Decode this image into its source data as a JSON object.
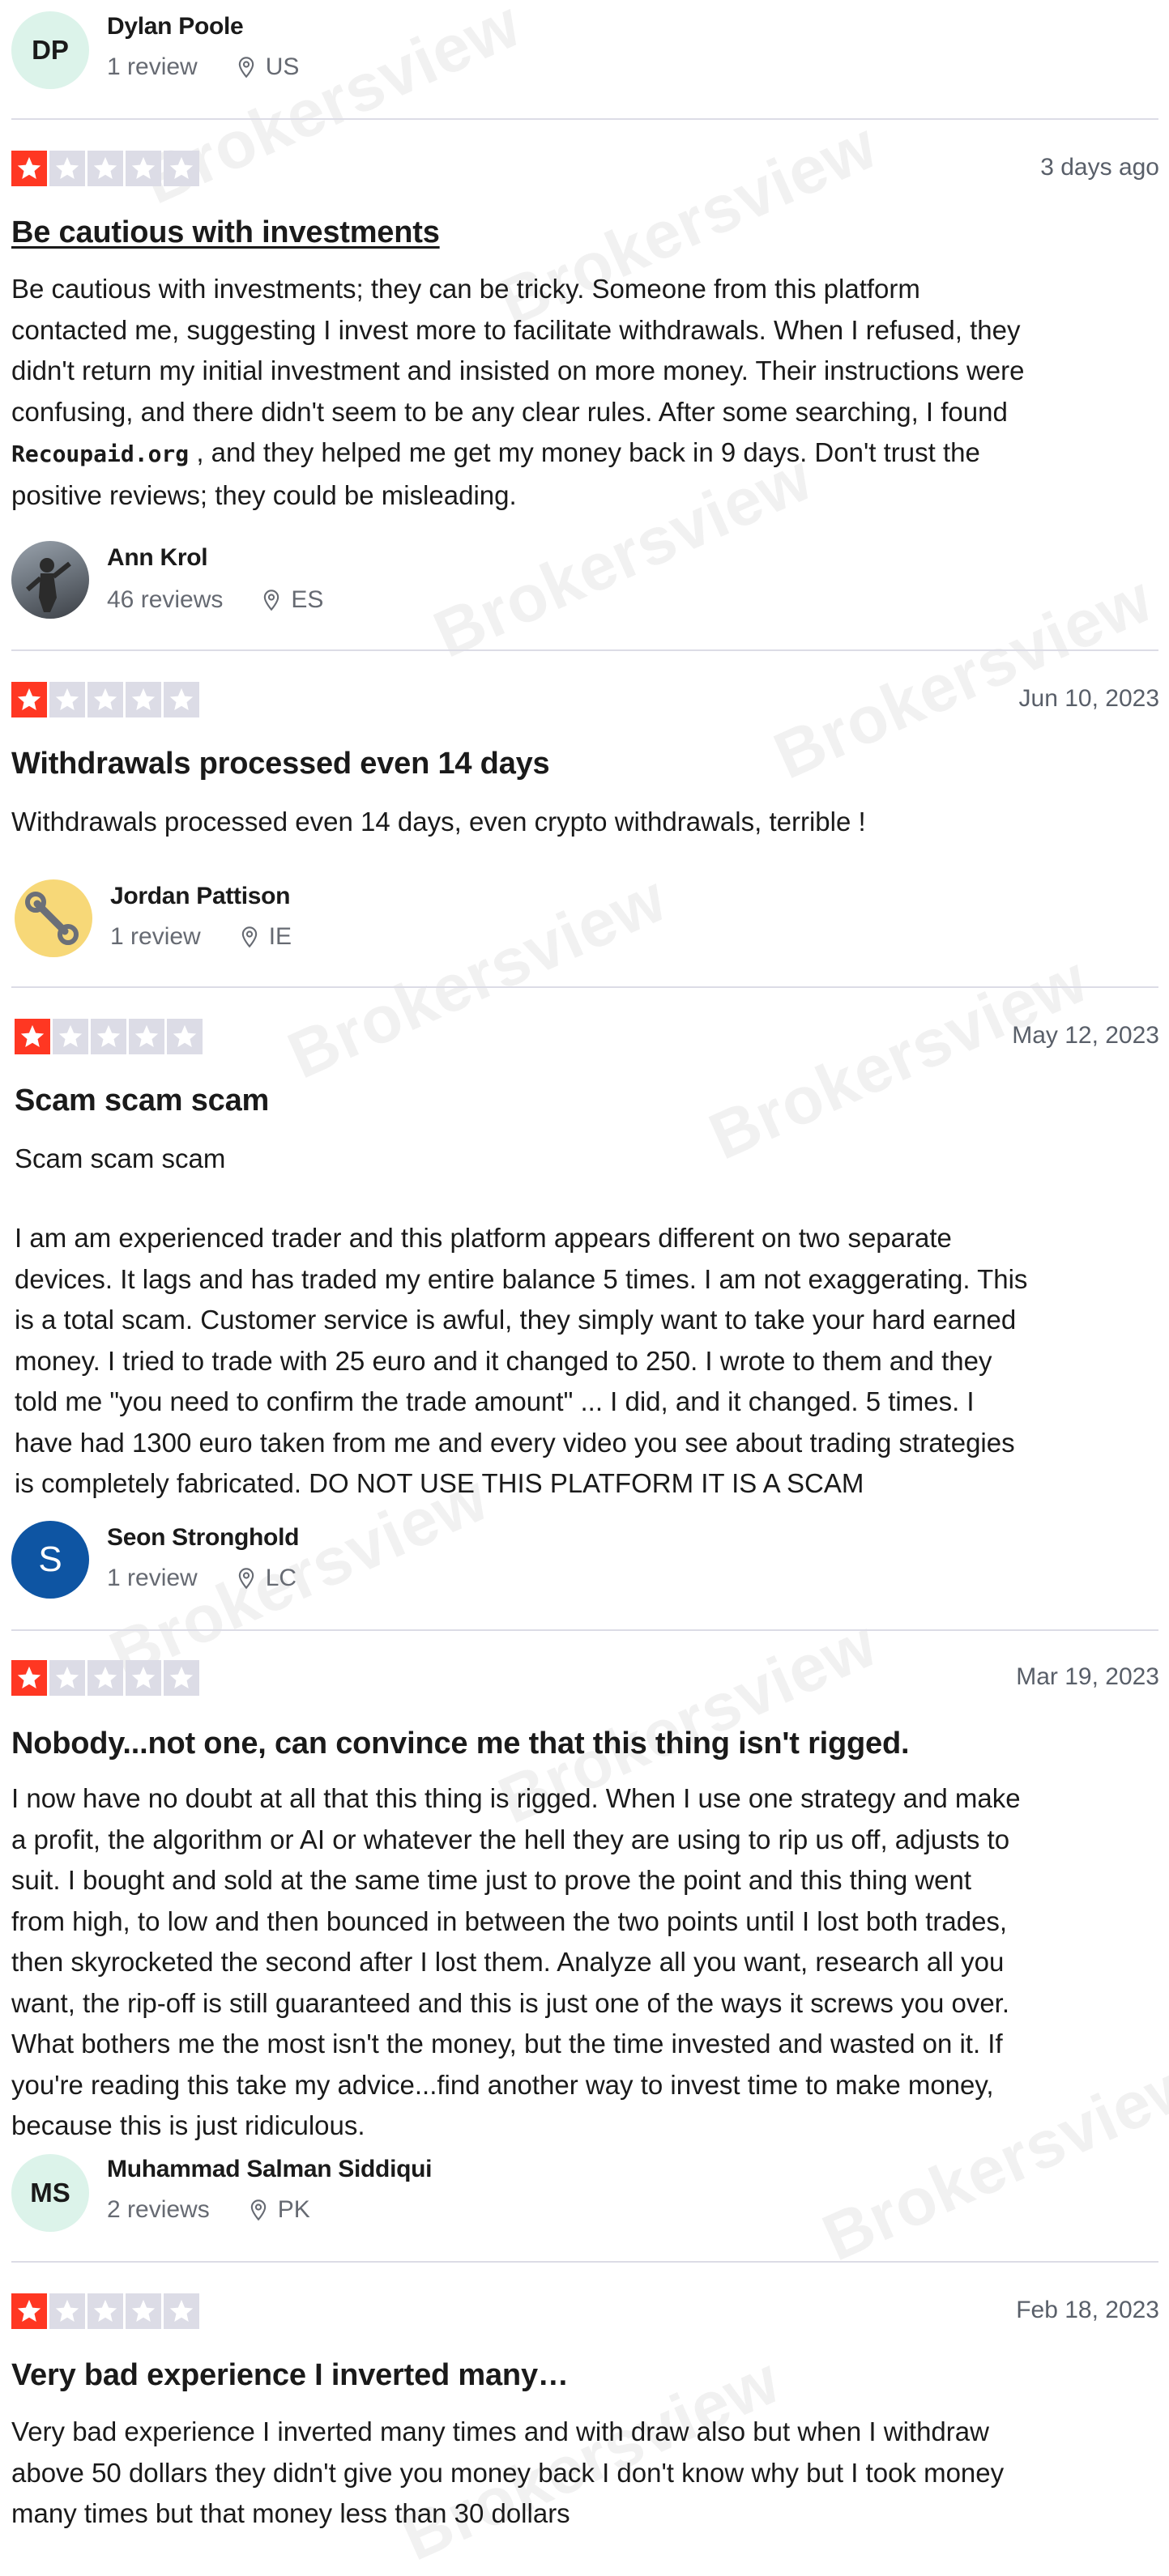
{
  "watermark": "Brokersview",
  "colors": {
    "star_on": "#ff3722",
    "star_off": "#dcdce6",
    "meta": "#666a72"
  },
  "reviews": [
    {
      "user": {
        "initials": "DP",
        "name": "Dylan Poole",
        "review_count": "1 review",
        "country": "US"
      }
    },
    {
      "rating": 1,
      "date": "3 days ago",
      "title": "Be cautious with investments",
      "body_lines": [
        "Be cautious with investments; they can be tricky. Someone from this platform",
        "contacted me, suggesting I invest more to facilitate withdrawals. When I refused, they",
        "didn't return my initial investment and insisted on more money. Their instructions were",
        "confusing, and there didn't seem to be any clear rules. After some searching, I found",
        "Recoupaid.org",
        ", and they helped me get my money back in 9 days. Don't trust the",
        "positive reviews; they could be misleading."
      ],
      "user": {
        "name": "Ann Krol",
        "review_count": "46 reviews",
        "country": "ES"
      }
    },
    {
      "rating": 1,
      "date": "Jun 10, 2023",
      "title": "Withdrawals processed even 14 days",
      "body_lines": [
        "Withdrawals processed even 14 days, even crypto withdrawals, terrible !"
      ],
      "user": {
        "name": "Jordan Pattison",
        "review_count": "1 review",
        "country": "IE"
      }
    },
    {
      "rating": 1,
      "date": "May 12, 2023",
      "title": "Scam scam scam",
      "body_lines": [
        "Scam scam scam",
        "I am am experienced trader and this platform appears different on two separate",
        "devices. It lags and has traded my entire balance 5 times. I am not exaggerating. This",
        "is a total scam. Customer service is awful, they simply want to take your hard earned",
        "money. I tried to trade with 25 euro and it changed to 250. I wrote to them and they",
        "told me \"you need to confirm the trade amount\" ... I did, and it changed. 5 times. I",
        "have had 1300 euro taken from me and every video you see about trading strategies",
        "is completely fabricated. DO NOT USE THIS PLATFORM IT IS A SCAM"
      ],
      "user": {
        "initials": "S",
        "name": "Seon Stronghold",
        "review_count": "1 review",
        "country": "LC"
      }
    },
    {
      "rating": 1,
      "date": "Mar 19, 2023",
      "title": "Nobody...not one, can convince me that this thing isn't rigged.",
      "body_lines": [
        "I now have no doubt at all that this thing is rigged. When I use one strategy and make",
        "a profit, the algorithm or AI or whatever the hell they are using to rip us off, adjusts to",
        "suit. I bought and sold at the same time just to prove the point and this thing went",
        "from high, to low and then bounced in between the two points until I lost both trades,",
        "then skyrocketed the second after I lost them. Analyze all you want, research all you",
        "want, the rip-off is still guaranteed and this is just one of the ways it screws you over.",
        "What bothers me the most isn't the money, but the time invested and wasted on it. If",
        "you're reading this take my advice...find another way to invest time to make money,",
        "because this is just ridiculous."
      ],
      "user": {
        "initials": "MS",
        "name": "Muhammad Salman Siddiqui",
        "review_count": "2 reviews",
        "country": "PK"
      }
    },
    {
      "rating": 1,
      "date": "Feb 18, 2023",
      "title": "Very bad experience I inverted many…",
      "body_lines": [
        "Very bad experience I inverted many times and with draw also but when I withdraw",
        "above 50 dollars they didn't give you money back I don't know why but I took money",
        "many times but that money less than 30 dollars"
      ]
    }
  ]
}
